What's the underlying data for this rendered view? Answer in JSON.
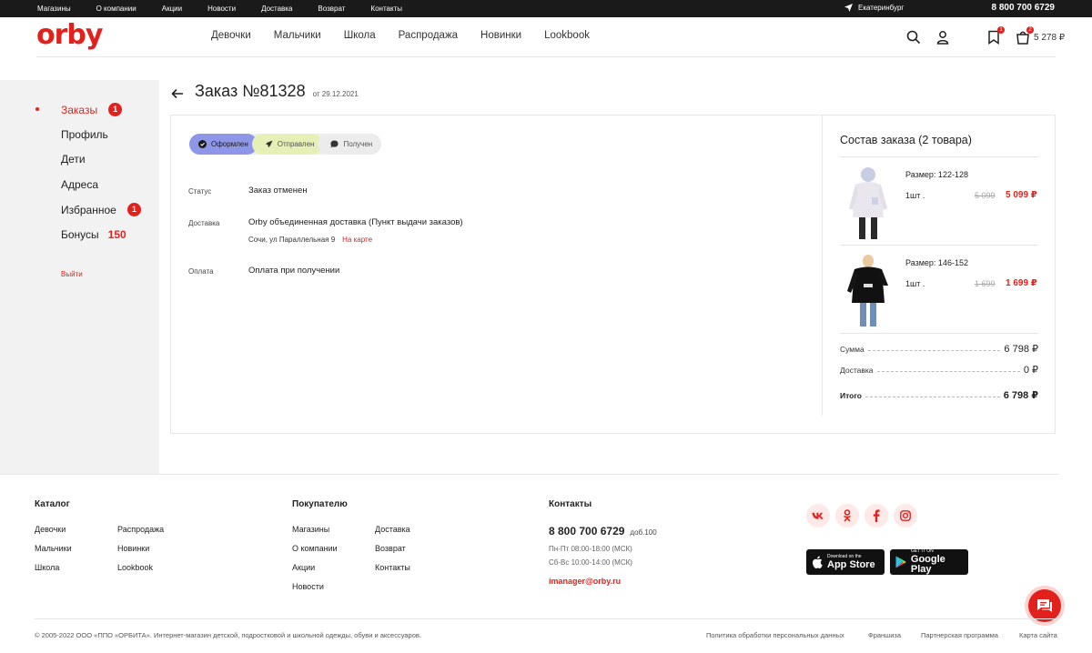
{
  "topbar": {
    "links": [
      "Магазины",
      "О компании",
      "Акции",
      "Новости",
      "Доставка",
      "Возврат",
      "Контакты"
    ],
    "city": "Екатеринбург",
    "phone": "8 800 700 6729"
  },
  "header": {
    "logo": "orby",
    "nav": [
      "Девочки",
      "Мальчики",
      "Школа",
      "Распродажа",
      "Новинки",
      "Lookbook"
    ],
    "favorites_badge": "1",
    "cart_badge": "2",
    "cart_total": "5 278 ₽"
  },
  "sidebar": {
    "items": [
      {
        "label": "Заказы",
        "badge": "1"
      },
      {
        "label": "Профиль"
      },
      {
        "label": "Дети"
      },
      {
        "label": "Адреса"
      },
      {
        "label": "Избранное",
        "badge": "1"
      },
      {
        "label": "Бонусы",
        "bonus": "150"
      }
    ],
    "logout": "Выйти"
  },
  "order": {
    "title": "Заказ №81328",
    "date": "от 29.12.2021",
    "steps": [
      "Оформлен",
      "Отправлен",
      "Получен"
    ],
    "status_label": "Статус",
    "status_value": "Заказ отменен",
    "delivery_label": "Доставка",
    "delivery_value": "Orby объединенная доставка (Пункт выдачи заказов)",
    "delivery_address": "Сочи, ул Параллельная 9",
    "map_link": "На карте",
    "payment_label": "Оплата",
    "payment_value": "Оплата при получении"
  },
  "composition": {
    "title": "Состав заказа (2 товара)",
    "products": [
      {
        "size": "Размер: 122-128",
        "qty": "1шт .",
        "old_price": "5 099",
        "price": "5 099 ₽"
      },
      {
        "size": "Размер: 146-152",
        "qty": "1шт .",
        "old_price": "1 699",
        "price": "1 699 ₽"
      }
    ],
    "sum_label": "Сумма",
    "sum_value": "6 798 ₽",
    "delivery_label": "Доставка",
    "delivery_value": "0 ₽",
    "total_label": "Итого",
    "total_value": "6 798 ₽"
  },
  "footer": {
    "catalog_title": "Каталог",
    "catalog_links": [
      "Девочки",
      "Мальчики",
      "Школа",
      "Распродажа",
      "Новинки",
      "Lookbook"
    ],
    "buyer_title": "Покупателю",
    "buyer_links": [
      "Магазины",
      "О компании",
      "Акции",
      "Новости",
      "Доставка",
      "Возврат",
      "Контакты"
    ],
    "contacts_title": "Контакты",
    "phone": "8 800 700 6729",
    "ext": "доб.100",
    "hours1": "Пн-Пт 08:00-18:00 (МСК)",
    "hours2": "Сб-Вс 10:00-14:00 (МСК)",
    "email": "imanager@orby.ru",
    "app_store_small": "Download on the",
    "app_store": "App Store",
    "google_play_small": "GET IT ON",
    "google_play": "Google Play",
    "copyright": "© 2005-2022 ООО «ППО «ОРБИТА». Интернет-магазин детской, подростковой и школьной одежды, обуви и аксессуаров.",
    "bottom_links": [
      "Политика обработки персональных данных",
      "Франшиза",
      "Партнерская программа",
      "Карта сайта"
    ]
  },
  "colors": {
    "accent": "#e3211c",
    "step_active": "#8e96e8",
    "step_sent": "#e6f0b6"
  }
}
